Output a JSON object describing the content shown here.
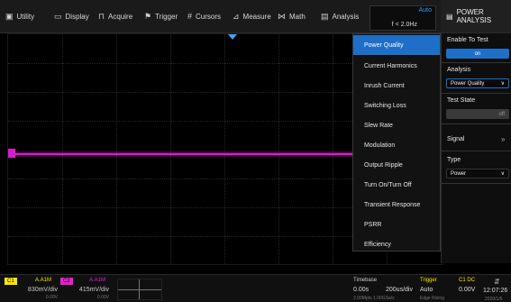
{
  "menu": [
    {
      "label": "Utility",
      "icon": "utility-icon",
      "glyph": "▣"
    },
    {
      "label": "Display",
      "icon": "display-icon",
      "glyph": "▭"
    },
    {
      "label": "Acquire",
      "icon": "acquire-icon",
      "glyph": "⊓"
    },
    {
      "label": "Trigger",
      "icon": "trigger-icon",
      "glyph": "⚑"
    },
    {
      "label": "Cursors",
      "icon": "cursors-icon",
      "glyph": "#"
    },
    {
      "label": "Measure",
      "icon": "measure-icon",
      "glyph": "⊿"
    },
    {
      "label": "Math",
      "icon": "math-icon",
      "glyph": "⋈"
    },
    {
      "label": "Analysis",
      "icon": "analysis-icon",
      "glyph": "▤"
    }
  ],
  "freq": {
    "auto": "Auto",
    "value": "f < 2.0Hz"
  },
  "panel_title": "POWER ANALYSIS",
  "dropdown": {
    "selected": 0,
    "items": [
      "Power Quality",
      "Current Harmonics",
      "Inrush Current",
      "Switching Loss",
      "Slew Rate",
      "Modulation",
      "Output Ripple",
      "Turn On/Turn Off",
      "Transient Response",
      "PSRR",
      "Efficiency"
    ]
  },
  "panel": {
    "enable_label": "Enable To Test",
    "enable_value": "on",
    "analysis_label": "Analysis",
    "analysis_value": "Power Quality",
    "test_state_label": "Test State",
    "test_state_value": "off",
    "signal_label": "Signal",
    "type_label": "Type",
    "type_value": "Power"
  },
  "status": {
    "ch1": {
      "tag": "C1",
      "coupling": "A.A1M",
      "volts": "830mV/div",
      "offset": "0.00V"
    },
    "ch2": {
      "tag": "C2",
      "coupling": "A.A1M",
      "volts": "415mV/div",
      "offset": "0.00V"
    },
    "timebase_label": "Timebase",
    "timebase_delay": "0.00s",
    "timebase_scale": "200us/div",
    "timebase_sub": "2.00Mpts  1.00GSa/s",
    "trigger_label": "Trigger",
    "trigger_src": "C1 DC",
    "trigger_mode": "Auto",
    "trigger_level": "0.00V",
    "trigger_sub": "Edge  Rising",
    "time": "12:07:26",
    "date": "2020/1/6"
  },
  "colors": {
    "ch1": "#ffe600",
    "ch2": "#e91ed4",
    "accent": "#1f6fc9"
  }
}
